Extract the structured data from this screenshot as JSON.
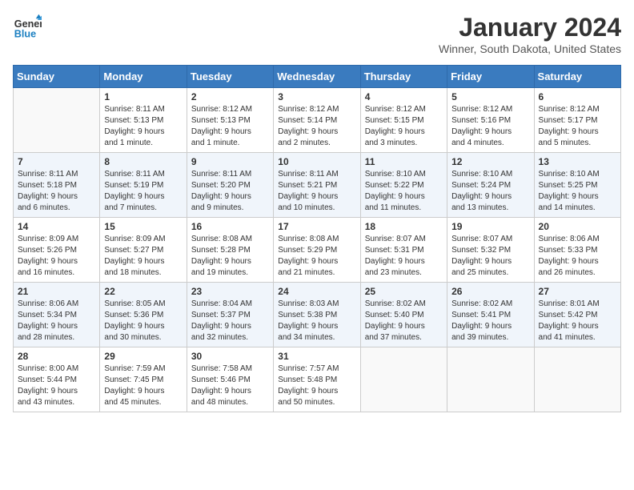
{
  "header": {
    "logo_line1": "General",
    "logo_line2": "Blue",
    "month": "January 2024",
    "location": "Winner, South Dakota, United States"
  },
  "weekdays": [
    "Sunday",
    "Monday",
    "Tuesday",
    "Wednesday",
    "Thursday",
    "Friday",
    "Saturday"
  ],
  "weeks": [
    [
      {
        "day": "",
        "info": ""
      },
      {
        "day": "1",
        "info": "Sunrise: 8:11 AM\nSunset: 5:13 PM\nDaylight: 9 hours\nand 1 minute."
      },
      {
        "day": "2",
        "info": "Sunrise: 8:12 AM\nSunset: 5:13 PM\nDaylight: 9 hours\nand 1 minute."
      },
      {
        "day": "3",
        "info": "Sunrise: 8:12 AM\nSunset: 5:14 PM\nDaylight: 9 hours\nand 2 minutes."
      },
      {
        "day": "4",
        "info": "Sunrise: 8:12 AM\nSunset: 5:15 PM\nDaylight: 9 hours\nand 3 minutes."
      },
      {
        "day": "5",
        "info": "Sunrise: 8:12 AM\nSunset: 5:16 PM\nDaylight: 9 hours\nand 4 minutes."
      },
      {
        "day": "6",
        "info": "Sunrise: 8:12 AM\nSunset: 5:17 PM\nDaylight: 9 hours\nand 5 minutes."
      }
    ],
    [
      {
        "day": "7",
        "info": "Sunrise: 8:11 AM\nSunset: 5:18 PM\nDaylight: 9 hours\nand 6 minutes."
      },
      {
        "day": "8",
        "info": "Sunrise: 8:11 AM\nSunset: 5:19 PM\nDaylight: 9 hours\nand 7 minutes."
      },
      {
        "day": "9",
        "info": "Sunrise: 8:11 AM\nSunset: 5:20 PM\nDaylight: 9 hours\nand 9 minutes."
      },
      {
        "day": "10",
        "info": "Sunrise: 8:11 AM\nSunset: 5:21 PM\nDaylight: 9 hours\nand 10 minutes."
      },
      {
        "day": "11",
        "info": "Sunrise: 8:10 AM\nSunset: 5:22 PM\nDaylight: 9 hours\nand 11 minutes."
      },
      {
        "day": "12",
        "info": "Sunrise: 8:10 AM\nSunset: 5:24 PM\nDaylight: 9 hours\nand 13 minutes."
      },
      {
        "day": "13",
        "info": "Sunrise: 8:10 AM\nSunset: 5:25 PM\nDaylight: 9 hours\nand 14 minutes."
      }
    ],
    [
      {
        "day": "14",
        "info": "Sunrise: 8:09 AM\nSunset: 5:26 PM\nDaylight: 9 hours\nand 16 minutes."
      },
      {
        "day": "15",
        "info": "Sunrise: 8:09 AM\nSunset: 5:27 PM\nDaylight: 9 hours\nand 18 minutes."
      },
      {
        "day": "16",
        "info": "Sunrise: 8:08 AM\nSunset: 5:28 PM\nDaylight: 9 hours\nand 19 minutes."
      },
      {
        "day": "17",
        "info": "Sunrise: 8:08 AM\nSunset: 5:29 PM\nDaylight: 9 hours\nand 21 minutes."
      },
      {
        "day": "18",
        "info": "Sunrise: 8:07 AM\nSunset: 5:31 PM\nDaylight: 9 hours\nand 23 minutes."
      },
      {
        "day": "19",
        "info": "Sunrise: 8:07 AM\nSunset: 5:32 PM\nDaylight: 9 hours\nand 25 minutes."
      },
      {
        "day": "20",
        "info": "Sunrise: 8:06 AM\nSunset: 5:33 PM\nDaylight: 9 hours\nand 26 minutes."
      }
    ],
    [
      {
        "day": "21",
        "info": "Sunrise: 8:06 AM\nSunset: 5:34 PM\nDaylight: 9 hours\nand 28 minutes."
      },
      {
        "day": "22",
        "info": "Sunrise: 8:05 AM\nSunset: 5:36 PM\nDaylight: 9 hours\nand 30 minutes."
      },
      {
        "day": "23",
        "info": "Sunrise: 8:04 AM\nSunset: 5:37 PM\nDaylight: 9 hours\nand 32 minutes."
      },
      {
        "day": "24",
        "info": "Sunrise: 8:03 AM\nSunset: 5:38 PM\nDaylight: 9 hours\nand 34 minutes."
      },
      {
        "day": "25",
        "info": "Sunrise: 8:02 AM\nSunset: 5:40 PM\nDaylight: 9 hours\nand 37 minutes."
      },
      {
        "day": "26",
        "info": "Sunrise: 8:02 AM\nSunset: 5:41 PM\nDaylight: 9 hours\nand 39 minutes."
      },
      {
        "day": "27",
        "info": "Sunrise: 8:01 AM\nSunset: 5:42 PM\nDaylight: 9 hours\nand 41 minutes."
      }
    ],
    [
      {
        "day": "28",
        "info": "Sunrise: 8:00 AM\nSunset: 5:44 PM\nDaylight: 9 hours\nand 43 minutes."
      },
      {
        "day": "29",
        "info": "Sunrise: 7:59 AM\nSunset: 7:45 PM\nDaylight: 9 hours\nand 45 minutes."
      },
      {
        "day": "30",
        "info": "Sunrise: 7:58 AM\nSunset: 5:46 PM\nDaylight: 9 hours\nand 48 minutes."
      },
      {
        "day": "31",
        "info": "Sunrise: 7:57 AM\nSunset: 5:48 PM\nDaylight: 9 hours\nand 50 minutes."
      },
      {
        "day": "",
        "info": ""
      },
      {
        "day": "",
        "info": ""
      },
      {
        "day": "",
        "info": ""
      }
    ]
  ]
}
